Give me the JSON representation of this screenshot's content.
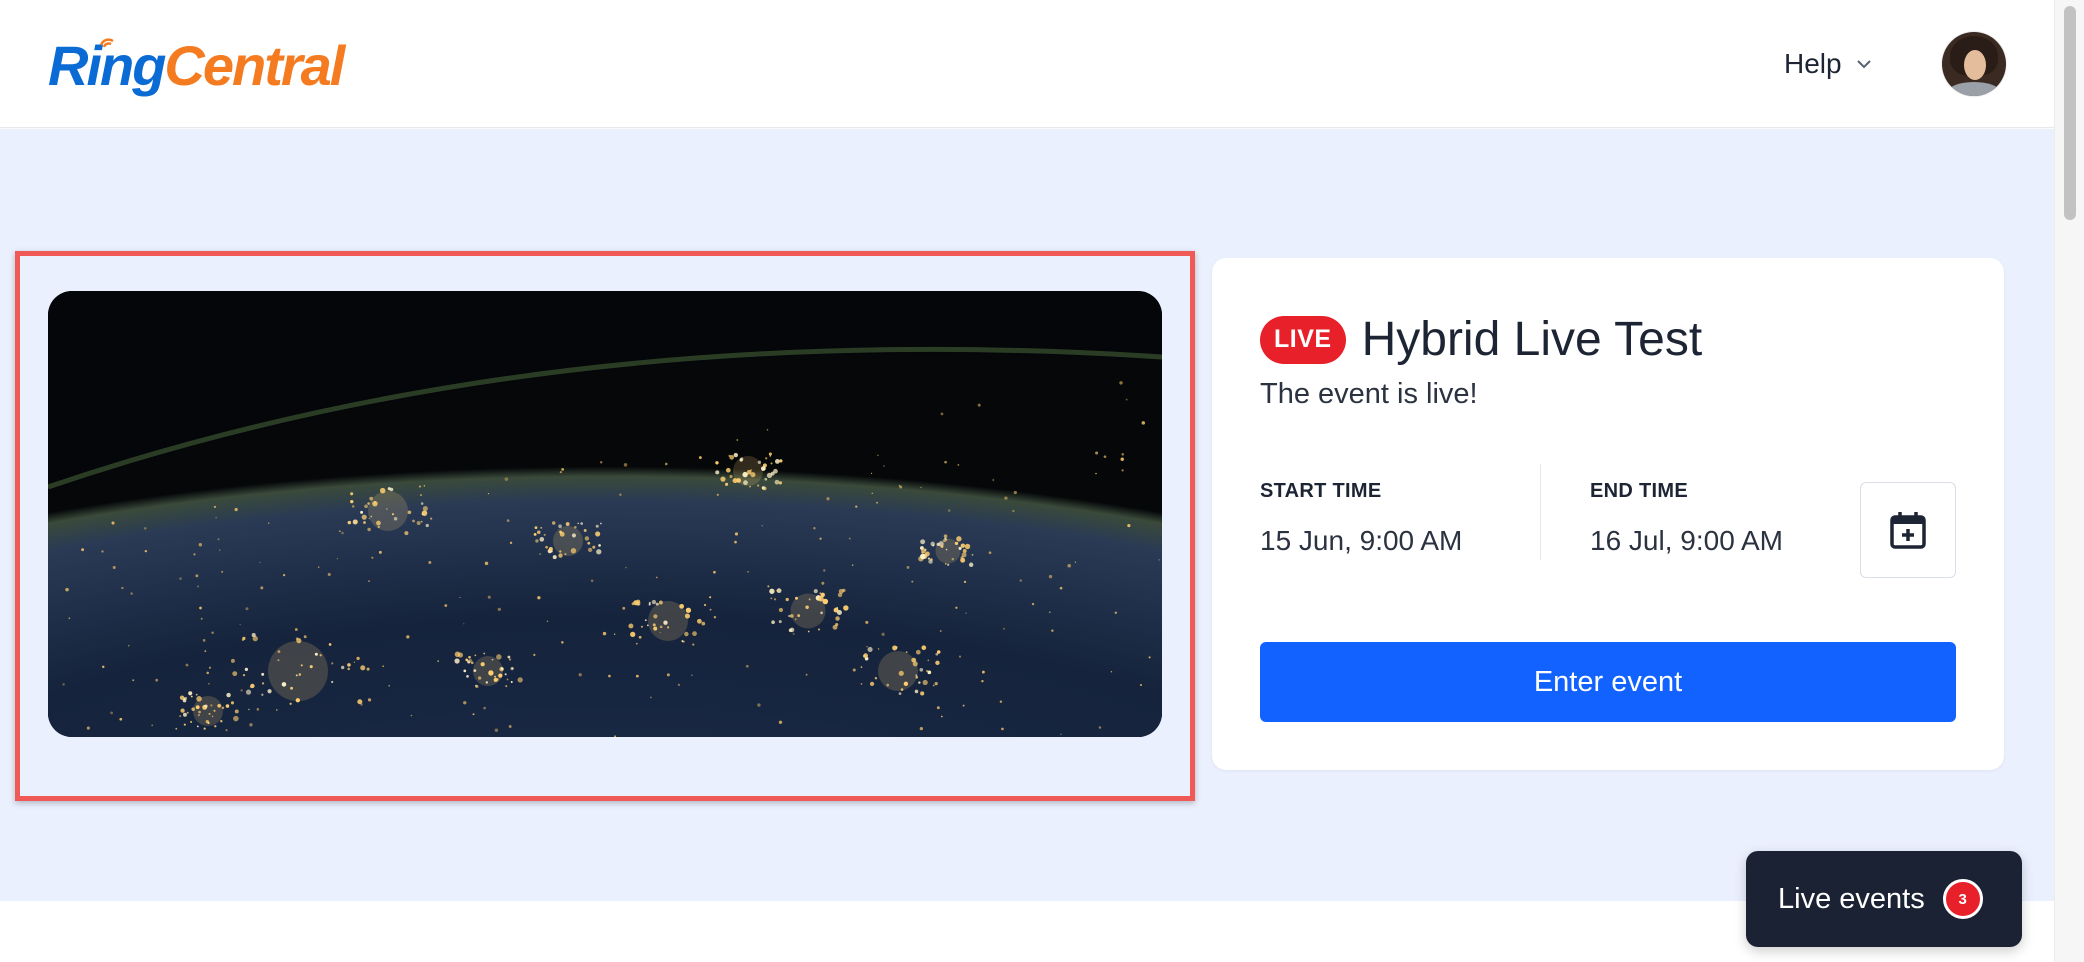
{
  "header": {
    "logo_ring": "Ring",
    "logo_central": "Central",
    "help_label": "Help"
  },
  "event": {
    "badge": "LIVE",
    "title": "Hybrid Live Test",
    "status": "The event is live!",
    "start_label": "START TIME",
    "start_value": "15 Jun, 9:00 AM",
    "end_label": "END TIME",
    "end_value": "16 Jul, 9:00 AM",
    "enter_label": "Enter event"
  },
  "live_events": {
    "label": "Live events",
    "count": "3"
  },
  "icons": {
    "help_chevron": "chevron-down-icon",
    "calendar": "calendar-add-icon",
    "logo_signal": "wifi-icon"
  },
  "colors": {
    "brand_blue": "#0a6bd4",
    "brand_orange": "#f47b20",
    "primary_button": "#1262ff",
    "live_red": "#e8202a",
    "highlight_frame": "#ef5a56"
  }
}
